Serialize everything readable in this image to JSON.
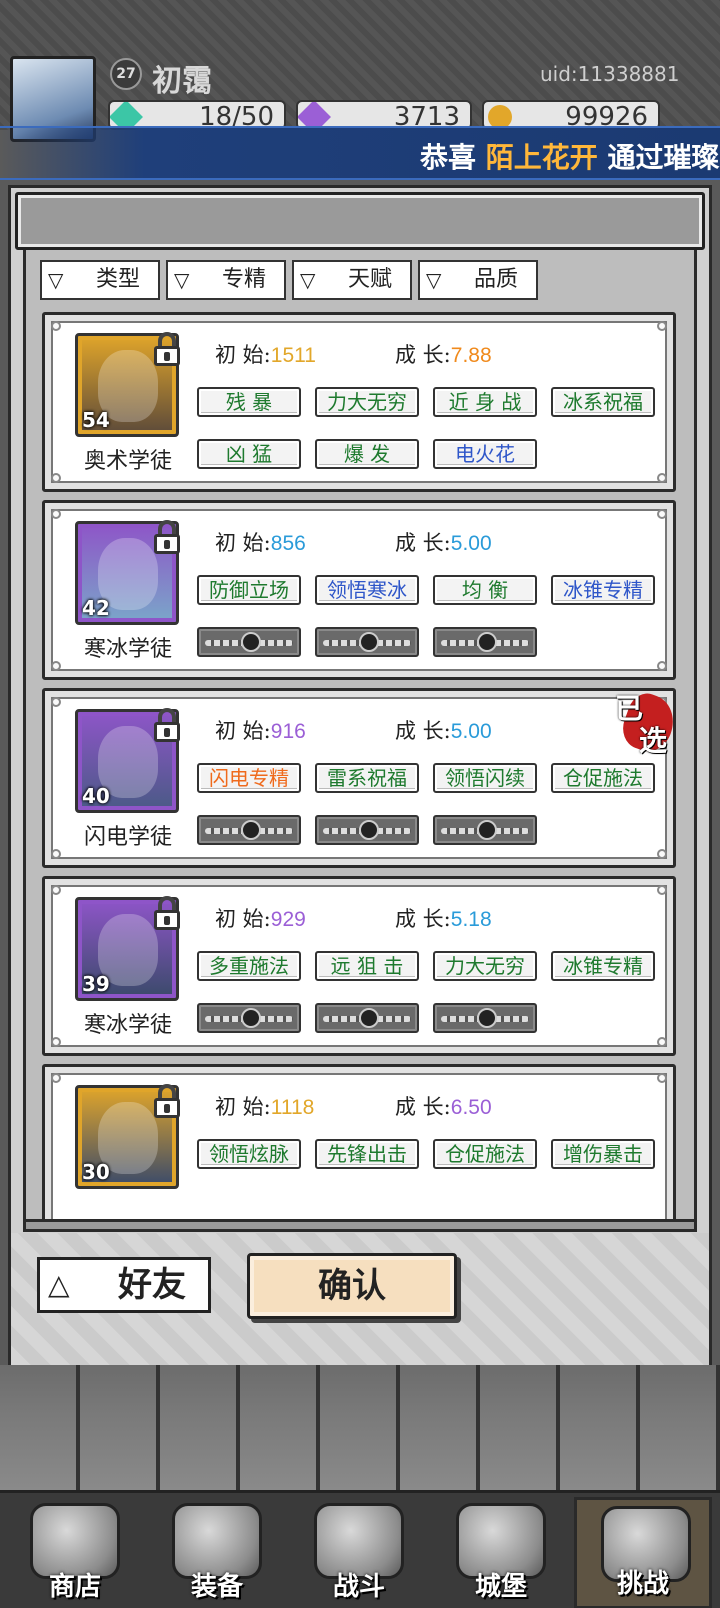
{
  "player": {
    "level": "27",
    "name": "初霭",
    "uid": "uid:11338881",
    "resources": [
      {
        "icon": "green-gem-icon",
        "value": "18/50",
        "color": "#3cc6a6"
      },
      {
        "icon": "purple-gem-icon",
        "value": "3713",
        "color": "#9b5fd6"
      },
      {
        "icon": "gold-coin-icon",
        "value": "99926",
        "color": "#e2a72a"
      }
    ]
  },
  "banner": {
    "prefix": "恭喜",
    "highlight": "陌上花开",
    "suffix": "通过璀璨"
  },
  "filters": [
    "类型",
    "专精",
    "天赋",
    "品质"
  ],
  "stat_labels": {
    "initial": "初  始:",
    "growth": "成  长:"
  },
  "cards": [
    {
      "name": "奥术学徒",
      "level": "54",
      "frame": "#e0a52a",
      "portrait": "#5c4a3a",
      "initial": "1511",
      "initial_color": "#e2a72a",
      "growth": "7.88",
      "growth_color": "#f08a1c",
      "tags": [
        {
          "text": "残  暴",
          "style": "green"
        },
        {
          "text": "力大无穷",
          "style": "green"
        },
        {
          "text": "近 身 战",
          "style": "green"
        },
        {
          "text": "冰系祝福",
          "style": "green"
        },
        {
          "text": "凶  猛",
          "style": "green"
        },
        {
          "text": "爆  发",
          "style": "green"
        },
        {
          "text": "电火花",
          "style": "blue"
        }
      ],
      "locked_slots": 0,
      "selected": false
    },
    {
      "name": "寒冰学徒",
      "level": "42",
      "frame": "#8e55c8",
      "portrait": "#7aa6c9",
      "initial": "856",
      "initial_color": "#2a9bd9",
      "growth": "5.00",
      "growth_color": "#2a9bd9",
      "tags": [
        {
          "text": "防御立场",
          "style": "green"
        },
        {
          "text": "领悟寒冰",
          "style": "blue"
        },
        {
          "text": "均  衡",
          "style": "green"
        },
        {
          "text": "冰锥专精",
          "style": "blue"
        }
      ],
      "locked_slots": 3,
      "selected": false
    },
    {
      "name": "闪电学徒",
      "level": "40",
      "frame": "#8e55c8",
      "portrait": "#4a5a86",
      "initial": "916",
      "initial_color": "#9b5fd6",
      "growth": "5.00",
      "growth_color": "#2a9bd9",
      "tags": [
        {
          "text": "闪电专精",
          "style": "orange"
        },
        {
          "text": "雷系祝福",
          "style": "green"
        },
        {
          "text": "领悟闪续",
          "style": "green"
        },
        {
          "text": "仓促施法",
          "style": "green"
        }
      ],
      "locked_slots": 3,
      "selected": true,
      "selected_text": [
        "已",
        "选"
      ]
    },
    {
      "name": "寒冰学徒",
      "level": "39",
      "frame": "#8e55c8",
      "portrait": "#3a4a6a",
      "initial": "929",
      "initial_color": "#9b5fd6",
      "growth": "5.18",
      "growth_color": "#2a9bd9",
      "tags": [
        {
          "text": "多重施法",
          "style": "green"
        },
        {
          "text": "远 狙 击",
          "style": "green"
        },
        {
          "text": "力大无穷",
          "style": "green"
        },
        {
          "text": "冰锥专精",
          "style": "green"
        }
      ],
      "locked_slots": 3,
      "selected": false
    },
    {
      "name": "",
      "level": "30",
      "frame": "#e0a52a",
      "portrait": "#3a4a6a",
      "initial": "1118",
      "initial_color": "#e2a72a",
      "growth": "6.50",
      "growth_color": "#9b5fd6",
      "tags": [
        {
          "text": "领悟炫脉",
          "style": "green"
        },
        {
          "text": "先锋出击",
          "style": "green"
        },
        {
          "text": "仓促施法",
          "style": "green"
        },
        {
          "text": "增伤暴击",
          "style": "green"
        }
      ],
      "locked_slots": 0,
      "selected": false
    }
  ],
  "buttons": {
    "friends": "好友",
    "confirm": "确认"
  },
  "nav": [
    {
      "label": "商店",
      "icon": "shop-icon",
      "active": false
    },
    {
      "label": "装备",
      "icon": "equipment-bag-icon",
      "active": false
    },
    {
      "label": "战斗",
      "icon": "crossed-swords-icon",
      "active": false
    },
    {
      "label": "城堡",
      "icon": "castle-icon",
      "active": false
    },
    {
      "label": "挑战",
      "icon": "shield-crest-icon",
      "active": true
    }
  ]
}
